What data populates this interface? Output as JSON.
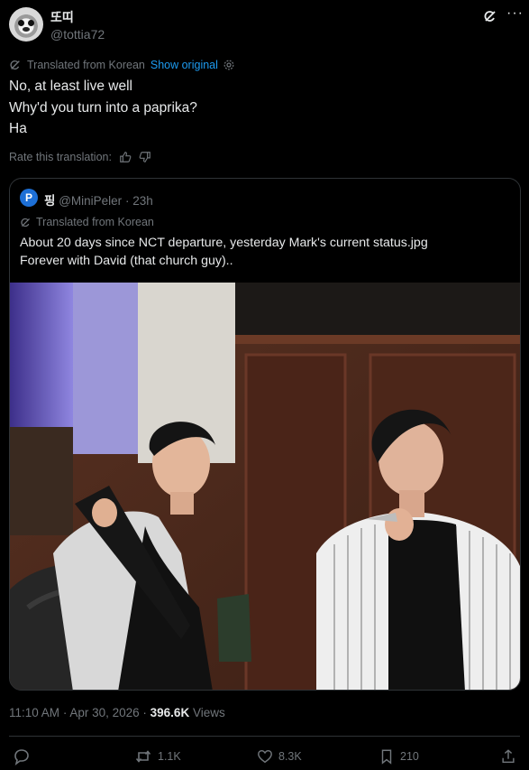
{
  "author": {
    "display_name": "또띠",
    "handle": "@tottia72"
  },
  "translation": {
    "label": "Translated from Korean",
    "show_original": "Show original"
  },
  "tweet": {
    "lines": [
      "No, at least live well",
      "Why'd you turn into a paprika?",
      "Ha"
    ]
  },
  "rate_label": "Rate this translation:",
  "quote": {
    "avatar_letter": "P",
    "name": "핑",
    "handle": "@MiniPeler",
    "time": "23h",
    "translated_label": "Translated from Korean",
    "lines": [
      "About 20 days since NCT departure, yesterday Mark's current status.jpg",
      "Forever with David (that church guy).."
    ]
  },
  "meta": {
    "time": "11:10 AM",
    "date": "Apr 30, 2026",
    "views_count": "396.6K",
    "views_label": "Views"
  },
  "actions": {
    "retweets": "1.1K",
    "likes": "8.3K",
    "bookmarks": "210"
  },
  "colors": {
    "background": "#000000",
    "text": "#e7e9ea",
    "muted": "#71767b",
    "accent": "#1d9bf0",
    "border": "#2f3336"
  },
  "icons": [
    "grok-icon",
    "more-icon",
    "translate-icon",
    "settings-icon",
    "thumbs-up-icon",
    "thumbs-down-icon",
    "reply-icon",
    "retweet-icon",
    "like-icon",
    "bookmark-icon",
    "share-icon"
  ]
}
